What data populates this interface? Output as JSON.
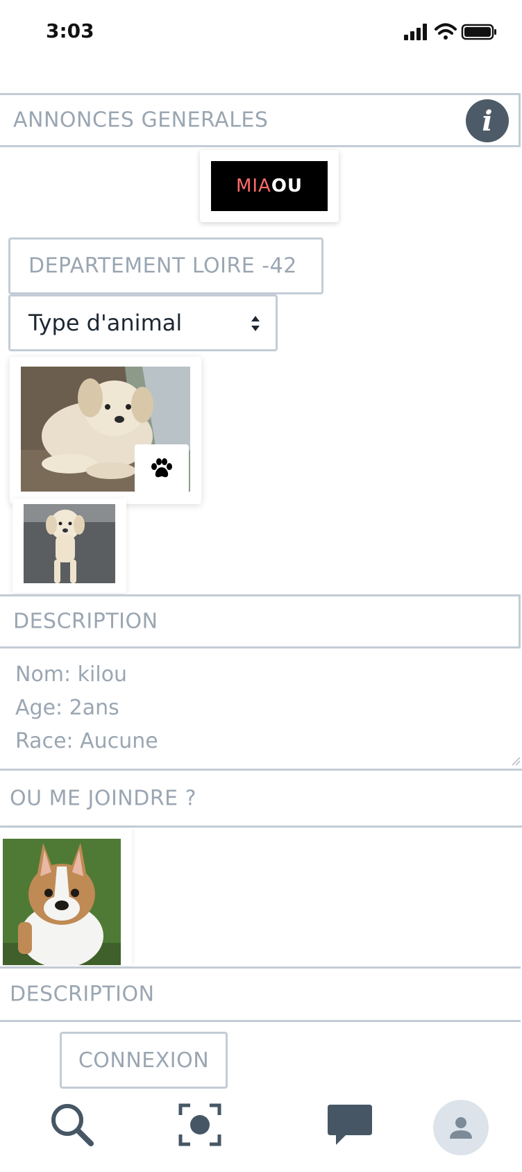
{
  "status_bar": {
    "time": "3:03",
    "icons": [
      "signal-icon",
      "wifi-icon",
      "battery-icon"
    ]
  },
  "header": {
    "title": "ANNONCES GENERALES",
    "info_icon": "info-icon",
    "info_label": "i"
  },
  "logo": {
    "part1": "MIA",
    "part2": "OU"
  },
  "location": {
    "label": "DEPARTEMENT LOIRE -42"
  },
  "filter": {
    "selected": "Type d'animal"
  },
  "listing1": {
    "paw_icon": "paw-icon",
    "description_header": "DESCRIPTION",
    "details": [
      "Nom: kilou",
      "Age: 2ans",
      "Race: Aucune"
    ],
    "contact_header": "OU ME JOINDRE ?"
  },
  "listing2": {
    "description_header": "DESCRIPTION"
  },
  "login": {
    "label": "CONNEXION"
  },
  "bottom_nav": {
    "items": [
      "search-icon",
      "camera-icon",
      "chat-icon",
      "profile-icon"
    ]
  },
  "colors": {
    "border": "#c3ccd6",
    "muted_text": "#9aa6b2",
    "dark": "#4d5b68",
    "brand_pink": "#ff6b6b"
  }
}
